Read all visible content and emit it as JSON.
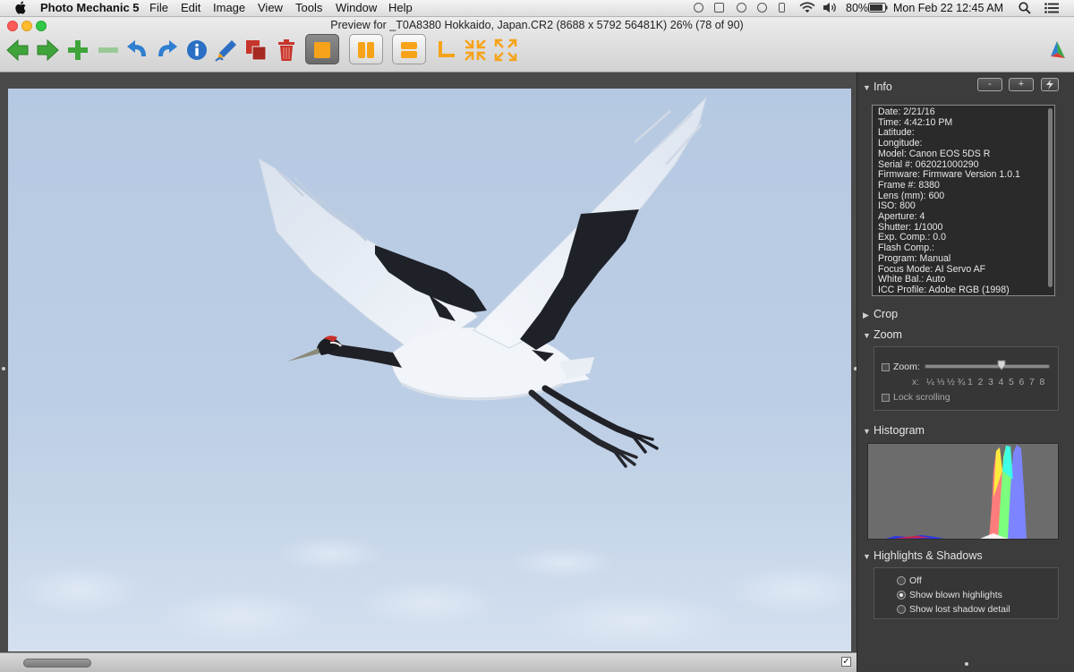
{
  "menubar": {
    "app_name": "Photo Mechanic 5",
    "menus": [
      "File",
      "Edit",
      "Image",
      "View",
      "Tools",
      "Window",
      "Help"
    ],
    "battery": "80%",
    "datetime": "Mon Feb 22  12:45 AM"
  },
  "window": {
    "title": "Preview for _T0A8380 Hokkaido, Japan.CR2 (8688 x 5792 56481K) 26% (78 of 90)"
  },
  "toolbar": {
    "icons": [
      "back-arrow-icon",
      "forward-arrow-icon",
      "add-icon",
      "remove-icon",
      "rotate-left-icon",
      "rotate-right-icon",
      "info-icon",
      "edit-pen-icon",
      "copy-icon",
      "trash-icon",
      "single-view-icon",
      "side-by-side-view-icon",
      "stacked-view-icon",
      "crop-icon",
      "zoom-out-icon",
      "zoom-in-icon",
      "app-logo-icon"
    ],
    "active": "single-view-icon"
  },
  "photo": {
    "subject": "red-crowned crane in flight",
    "sky_color": "#b9cbe3"
  },
  "panel": {
    "info": {
      "title": "Info",
      "minus_label": "-",
      "plus_label": "+",
      "lines": [
        "Date: 2/21/16",
        "Time: 4:42:10 PM",
        "Latitude:",
        "Longitude:",
        "Model: Canon EOS 5DS R",
        "Serial #: 062021000290",
        "Firmware: Firmware Version 1.0.1",
        "Frame #: 8380",
        "Lens (mm): 600",
        "ISO: 800",
        "Aperture: 4",
        "Shutter: 1/1000",
        "Exp. Comp.: 0.0",
        "Flash Comp.:",
        "Program: Manual",
        "Focus Mode: AI Servo AF",
        "White Bal.: Auto",
        "ICC Profile: Adobe RGB (1998)"
      ]
    },
    "crop": {
      "title": "Crop"
    },
    "zoom": {
      "title": "Zoom",
      "zoom_label": "Zoom:",
      "scale_prefix": "x:",
      "scale": [
        "¼",
        "⅓",
        "½",
        "¾",
        "1",
        "2",
        "3",
        "4",
        "5",
        "6",
        "7",
        "8"
      ],
      "slider_value": "4",
      "lock_label": "Lock scrolling"
    },
    "histogram": {
      "title": "Histogram"
    },
    "highlights": {
      "title": "Highlights & Shadows",
      "options": [
        "Off",
        "Show blown highlights",
        "Show lost shadow detail"
      ],
      "selected": "Show blown highlights"
    }
  }
}
